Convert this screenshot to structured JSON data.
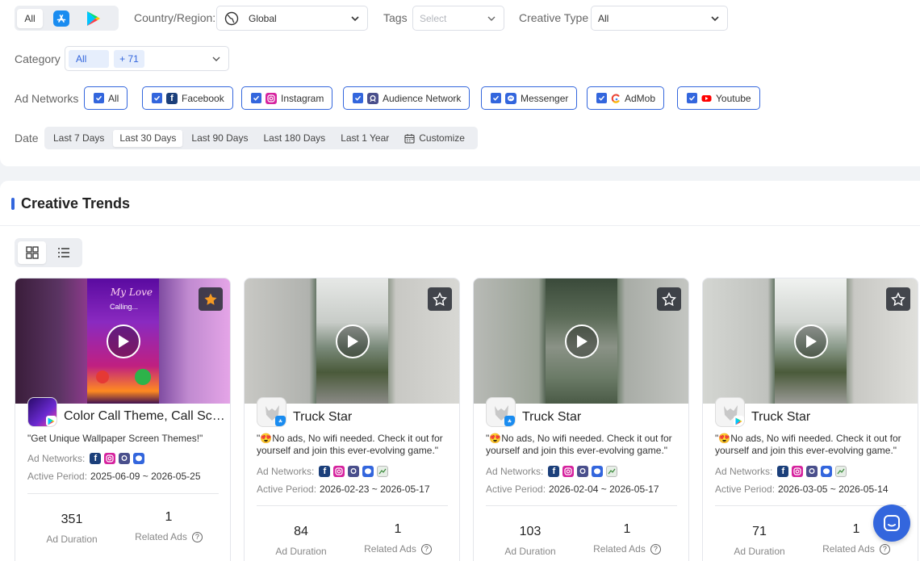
{
  "filters": {
    "store_all_label": "All",
    "store_icons": [
      "app-store-icon",
      "google-play-icon"
    ],
    "country_label": "Country/Region:",
    "country_value": "Global",
    "tags_label": "Tags",
    "tags_placeholder": "Select",
    "creative_type_label": "Creative Type",
    "creative_type_value": "All",
    "category_label": "Category",
    "category_all": "All",
    "category_more": "+ 71",
    "ad_networks_label": "Ad Networks",
    "ad_networks": [
      "All",
      "Facebook",
      "Instagram",
      "Audience Network",
      "Messenger",
      "AdMob",
      "Youtube"
    ],
    "date_label": "Date",
    "date_options": [
      "Last 7 Days",
      "Last 30 Days",
      "Last 90 Days",
      "Last 180 Days",
      "Last 1 Year",
      "Customize"
    ],
    "date_selected": "Last 30 Days"
  },
  "trends": {
    "title": "Creative Trends",
    "cards": [
      {
        "title": "Color Call Theme, Call Scr...",
        "desc": "\"Get Unique Wallpaper Screen Themes!\"",
        "networks_label": "Ad Networks:",
        "networks": [
          "facebook-icon",
          "instagram-icon",
          "audience-network-icon",
          "messenger-icon"
        ],
        "period_label": "Active Period:",
        "period": "2025-06-09 ~ 2026-05-25",
        "ad_duration": "351",
        "ad_duration_label": "Ad Duration",
        "related_ads": "1",
        "related_ads_label": "Related Ads",
        "favorited": true,
        "thumb_text_1": "My Love",
        "thumb_text_2": "Calling..."
      },
      {
        "title": "Truck Star",
        "desc": "\"😍No ads, No wifi needed. Check it out for yourself and join this ever-evolving game.\"",
        "networks_label": "Ad Networks:",
        "networks": [
          "facebook-icon",
          "instagram-icon",
          "audience-network-icon",
          "messenger-icon",
          "admob-icon"
        ],
        "period_label": "Active Period:",
        "period": "2026-02-23 ~ 2026-05-17",
        "ad_duration": "84",
        "ad_duration_label": "Ad Duration",
        "related_ads": "1",
        "related_ads_label": "Related Ads",
        "favorited": false
      },
      {
        "title": "Truck Star",
        "desc": "\"😍No ads, No wifi needed. Check it out for yourself and join this ever-evolving game.\"",
        "networks_label": "Ad Networks:",
        "networks": [
          "facebook-icon",
          "instagram-icon",
          "audience-network-icon",
          "messenger-icon",
          "admob-icon"
        ],
        "period_label": "Active Period:",
        "period": "2026-02-04 ~ 2026-05-17",
        "ad_duration": "103",
        "ad_duration_label": "Ad Duration",
        "related_ads": "1",
        "related_ads_label": "Related Ads",
        "favorited": false
      },
      {
        "title": "Truck Star",
        "desc": "\"😍No ads, No wifi needed. Check it out for yourself and join this ever-evolving game.\"",
        "networks_label": "Ad Networks:",
        "networks": [
          "facebook-icon",
          "instagram-icon",
          "audience-network-icon",
          "messenger-icon",
          "admob-icon"
        ],
        "period_label": "Active Period:",
        "period": "2026-03-05 ~ 2026-05-14",
        "ad_duration": "71",
        "ad_duration_label": "Ad Duration",
        "related_ads": "1",
        "related_ads_label": "Related Ads",
        "favorited": false
      }
    ]
  },
  "colors": {
    "accent": "#3366dd",
    "favorite": "#f59a23",
    "facebook": "#1877f2",
    "instagram": "#d6249f",
    "audience_network": "#4a4f8c",
    "messenger": "#0084ff",
    "youtube": "#ff0000"
  }
}
